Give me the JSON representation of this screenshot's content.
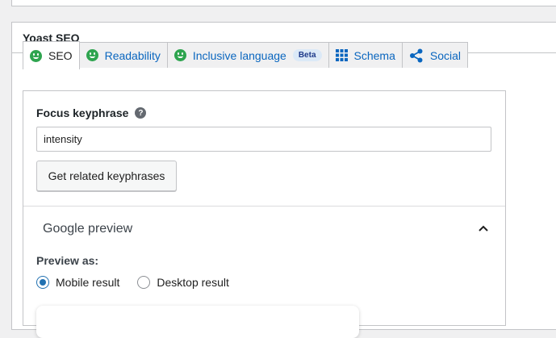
{
  "metabox": {
    "title": "Yoast SEO"
  },
  "tabs": [
    {
      "label": "SEO",
      "icon": "smiley-face-icon",
      "active": true
    },
    {
      "label": "Readability",
      "icon": "smiley-face-icon",
      "active": false
    },
    {
      "label": "Inclusive language",
      "icon": "smiley-face-icon",
      "badge": "Beta",
      "active": false
    },
    {
      "label": "Schema",
      "icon": "grid-icon",
      "active": false
    },
    {
      "label": "Social",
      "icon": "share-icon",
      "active": false
    }
  ],
  "seo": {
    "focus_label": "Focus keyphrase",
    "help_icon_glyph": "?",
    "focus_value": "intensity",
    "related_button": "Get related keyphrases"
  },
  "google_preview": {
    "title": "Google preview",
    "preview_as_label": "Preview as:",
    "options": [
      {
        "label": "Mobile result",
        "checked": true
      },
      {
        "label": "Desktop result",
        "checked": false
      }
    ]
  },
  "colors": {
    "link": "#0a66bf",
    "good": "#2ea44f",
    "radio": "#2271b1"
  }
}
